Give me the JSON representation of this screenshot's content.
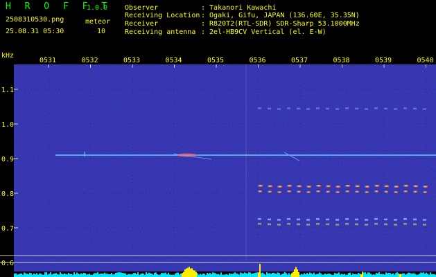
{
  "app": {
    "logo": "H R O F F T",
    "version": "1.0.0"
  },
  "file": {
    "name": "2508310530.png",
    "datetime": "25.08.31 05:30",
    "type_label": "meteor",
    "count": "10"
  },
  "info": [
    {
      "label": "Observer",
      "value": ": Takanori Kawachi"
    },
    {
      "label": "Receiving Location",
      "value": ": Ogaki, Gifu, JAPAN (136.60E, 35.35N)"
    },
    {
      "label": "Receiver",
      "value": ": R820T2(RTL-SDR) SDR-Sharp 53.1000MHz"
    },
    {
      "label": "Receiving antenna",
      "value": ": 2el-HB9CV Vertical (el. E-W)"
    }
  ],
  "axis": {
    "y_unit": "kHz",
    "y_ticks": [
      "1.1",
      "1.0",
      "0.9",
      "0.8",
      "0.7",
      "0.6"
    ],
    "x_ticks": [
      "0531",
      "0532",
      "0533",
      "0534",
      "0535",
      "0536",
      "0537",
      "0538",
      "0539",
      "0540"
    ]
  },
  "colors": {
    "text_green": "#00ff00",
    "text_yellow": "#ffff00",
    "background": "#000000",
    "spectrogram_bg": "#0a0a3c",
    "carrier": "#44ccff",
    "level_bar": "#00e5ff",
    "level_peak": "#ffee00"
  }
}
